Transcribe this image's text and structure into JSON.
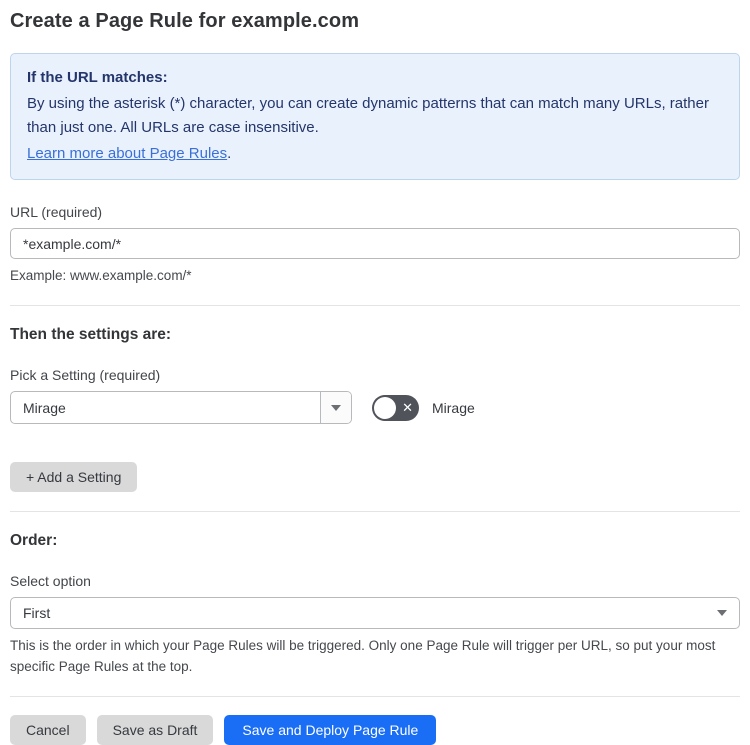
{
  "page": {
    "title": "Create a Page Rule for example.com"
  },
  "info_box": {
    "heading": "If the URL matches:",
    "body": "By using the asterisk (*) character, you can create dynamic patterns that can match many URLs, rather than just one. All URLs are case insensitive.",
    "link_label": "Learn more about Page Rules",
    "link_suffix": "."
  },
  "url_field": {
    "label": "URL (required)",
    "value": "*example.com/*",
    "helper": "Example: www.example.com/*"
  },
  "settings_section": {
    "heading": "Then the settings are:",
    "picker_label": "Pick a Setting (required)",
    "picker_value": "Mirage",
    "toggle": {
      "state": "off",
      "label": "Mirage"
    },
    "add_setting_label": "+ Add a Setting"
  },
  "order_section": {
    "heading": "Order:",
    "select_label": "Select option",
    "select_value": "First",
    "helper": "This is the order in which your Page Rules will be triggered. Only one Page Rule will trigger per URL, so put your most specific Page Rules at the top."
  },
  "actions": {
    "cancel_label": "Cancel",
    "save_draft_label": "Save as Draft",
    "save_deploy_label": "Save and Deploy Page Rule"
  },
  "colors": {
    "accent_blue": "#1a6ef5",
    "info_bg": "#e9f2fc",
    "info_border": "#bdd4ee",
    "info_text": "#24356b",
    "link_blue": "#3a6fd8",
    "toggle_off_bg": "#50535a",
    "button_gray": "#d9d9d9"
  }
}
